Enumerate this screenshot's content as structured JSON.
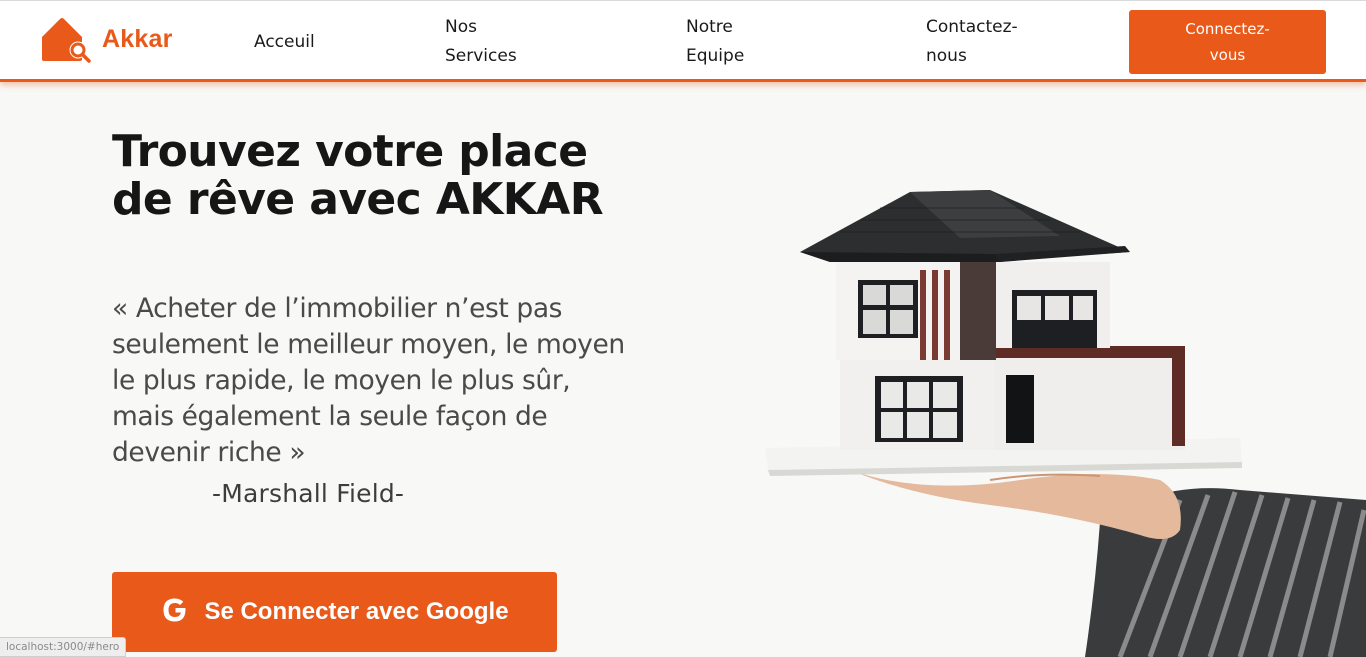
{
  "brand": {
    "name": "Akkar",
    "color": "#e8591a",
    "icon": "house-search-icon"
  },
  "nav": {
    "accueil": "Acceuil",
    "services": "Nos Services",
    "equipe": "Notre Equipe",
    "contact": "Contactez-nous",
    "login": "Connectez-vous"
  },
  "hero": {
    "title": "Trouvez votre place de rêve avec AKKAR",
    "quote": "« Acheter de l’immobilier n’est pas seulement le meilleur moyen, le moyen le plus rapide, le moyen le plus sûr, mais également la seule façon de devenir riche »",
    "author": "-Marshall Field-",
    "google_button": "Se Connecter avec Google",
    "google_icon": "google-g-icon",
    "image": "house-model-on-hand-illustration"
  },
  "status_bar": {
    "url": "localhost:3000/#hero"
  },
  "colors": {
    "accent": "#e8591a",
    "background": "#f8f8f6",
    "text": "#161616"
  }
}
